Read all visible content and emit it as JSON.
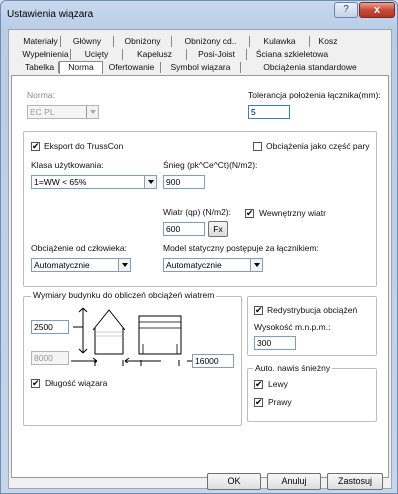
{
  "window": {
    "title": "Ustawienia wiązara",
    "help_glyph": "?",
    "close_glyph": "x"
  },
  "tabs": {
    "row1": [
      "Materiały",
      "Główny",
      "Obniżony",
      "Obniżony cd..",
      "Kulawka",
      "Kosz"
    ],
    "row2": [
      "Wypełnienia",
      "Ucięty",
      "Kapelusz",
      "Posi-Joist",
      "Ściana szkieletowa"
    ],
    "row3": [
      "Tabelka",
      "Norma",
      "Ofertowanie",
      "Symbol wiązara",
      "Obciążenia standardowe"
    ],
    "active": "Norma"
  },
  "norma": {
    "norma_label": "Norma:",
    "norma_value": "EC PL",
    "tolerancja_label": "Tolerancja położenia łącznika(mm):",
    "tolerancja_value": "5"
  },
  "settings": {
    "eksport_label": "Eksport do TrussCon",
    "eksport_checked": "✔",
    "obciazenia_czesc_pary_label": "Obciążenia jako część pary",
    "klasa_label": "Klasa użytkowania:",
    "klasa_value": "1=WW < 65%",
    "snieg_label": "Śnieg (pk^Ce^Ct)(N/m2):",
    "snieg_value": "900",
    "wiatr_label": "Wiatr (qp) (N/m2):",
    "wiatr_value": "600",
    "fx_label": "Fx",
    "wewnetrzny_wiatr_label": "Wewnętrzny wiatr",
    "wewnetrzny_wiatr_checked": "✔",
    "obciazenie_czlowieka_label": "Obciążenie od człowieka:",
    "obciazenie_czlowieka_value": "Automatycznie",
    "model_statyczny_label": "Model statyczny postępuje za łącznikiem:",
    "model_statyczny_value": "Automatycznie"
  },
  "wind_group": {
    "legend": "Wymiary budynku do obliczeń obciążeń wiatrem",
    "height_value": "2500",
    "width_value": "8000",
    "length_value": "16000",
    "dlugosc_label": "Długość wiązara",
    "dlugosc_checked": "✔"
  },
  "redystrybucja": {
    "label": "Redystrybucja obciążeń",
    "checked": "✔",
    "wysokosc_label": "Wysokość m.n.p.m.:",
    "wysokosc_value": "300"
  },
  "auto_nawis": {
    "legend": "Auto. nawis śnieżny",
    "lewy_label": "Lewy",
    "lewy_checked": "✔",
    "prawy_label": "Prawy",
    "prawy_checked": "✔"
  },
  "footer": {
    "ok": "OK",
    "anuluj": "Anuluj",
    "zastosuj": "Zastosuj"
  }
}
